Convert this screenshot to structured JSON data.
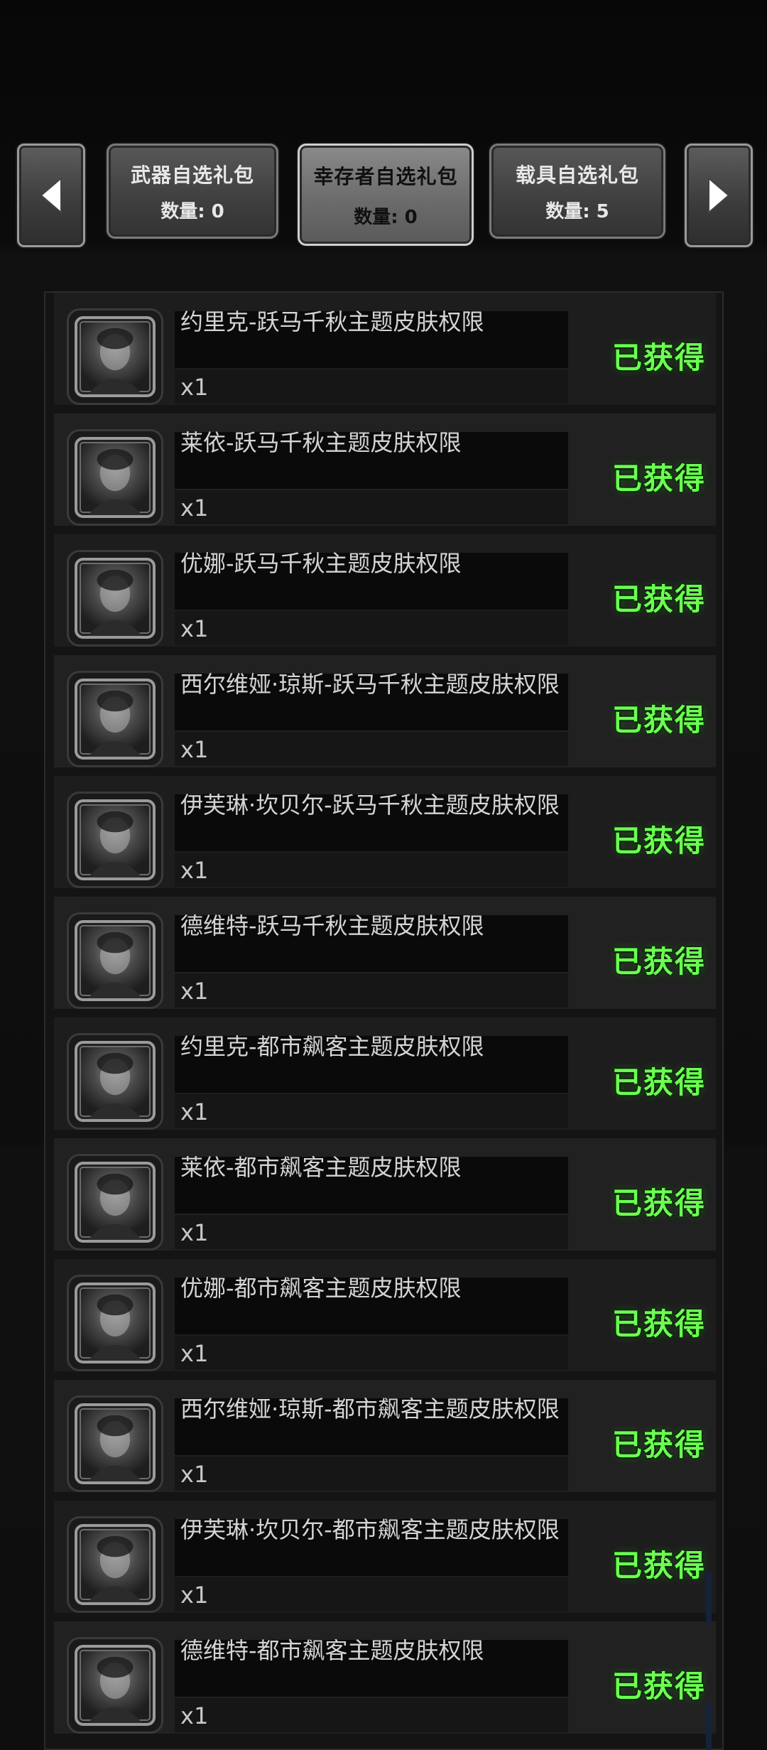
{
  "tabs": {
    "weapon": {
      "title": "武器自选礼包",
      "count": "数量: 0"
    },
    "survivor": {
      "title": "幸存者自选礼包",
      "count": "数量: 0"
    },
    "vehicle": {
      "title": "载具自选礼包",
      "count": "数量: 5"
    }
  },
  "items": [
    {
      "name": "约里克-跃马千秋主题皮肤权限",
      "qty": "x1",
      "status": "已获得",
      "icon": "man-straw-hat-portrait-icon"
    },
    {
      "name": "莱依-跃马千秋主题皮肤权限",
      "qty": "x1",
      "status": "已获得",
      "icon": "man-headband-portrait-icon"
    },
    {
      "name": "优娜-跃马千秋主题皮肤权限",
      "qty": "x1",
      "status": "已获得",
      "icon": "woman-long-hair-portrait-icon"
    },
    {
      "name": "西尔维娅·琼斯-跃马千秋主题皮肤权限",
      "qty": "x1",
      "status": "已获得",
      "icon": "woman-hat-portrait-icon"
    },
    {
      "name": "伊芙琳·坎贝尔-跃马千秋主题皮肤权限",
      "qty": "x1",
      "status": "已获得",
      "icon": "woman-scarf-portrait-icon"
    },
    {
      "name": "德维特-跃马千秋主题皮肤权限",
      "qty": "x1",
      "status": "已获得",
      "icon": "man-short-hair-portrait-icon"
    },
    {
      "name": "约里克-都市飙客主题皮肤权限",
      "qty": "x1",
      "status": "已获得",
      "icon": "biker-helmet-portrait-icon"
    },
    {
      "name": "莱依-都市飙客主题皮肤权限",
      "qty": "x1",
      "status": "已获得",
      "icon": "biker-hood-portrait-icon"
    },
    {
      "name": "优娜-都市飙客主题皮肤权限",
      "qty": "x1",
      "status": "已获得",
      "icon": "biker-visor-portrait-icon"
    },
    {
      "name": "西尔维娅·琼斯-都市飙客主题皮肤权限",
      "qty": "x1",
      "status": "已获得",
      "icon": "biker-mask-portrait-icon"
    },
    {
      "name": "伊芙琳·坎贝尔-都市飙客主题皮肤权限",
      "qty": "x1",
      "status": "已获得",
      "icon": "biker-fullface-helmet-portrait-icon"
    },
    {
      "name": "德维特-都市飙客主题皮肤权限",
      "qty": "x1",
      "status": "已获得",
      "icon": "biker-goggles-portrait-icon"
    }
  ]
}
